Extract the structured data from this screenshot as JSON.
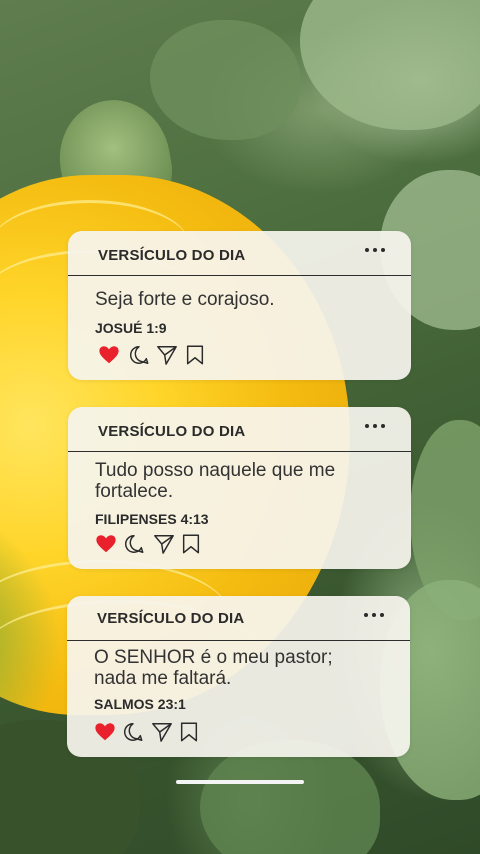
{
  "cards": [
    {
      "title": "VERSÍCULO DO DIA",
      "verse_lines": [
        "Seja forte e corajoso."
      ],
      "reference": "JOSUÉ 1:9"
    },
    {
      "title": "VERSÍCULO DO DIA",
      "verse_lines": [
        "Tudo posso naquele que me",
        "fortalece."
      ],
      "reference": "FILIPENSES 4:13"
    },
    {
      "title": "VERSÍCULO DO DIA",
      "verse_lines": [
        "O SENHOR é o meu pastor;",
        "nada me faltará."
      ],
      "reference": "SALMOS 23:1"
    }
  ],
  "icons": {
    "more": "more-horizontal-icon",
    "like": "heart-icon",
    "comment": "comment-icon",
    "share": "send-icon",
    "save": "bookmark-icon"
  },
  "colors": {
    "heart": "#e8212c",
    "text": "#2b2b2b",
    "card_background": "#f6f4ee"
  }
}
